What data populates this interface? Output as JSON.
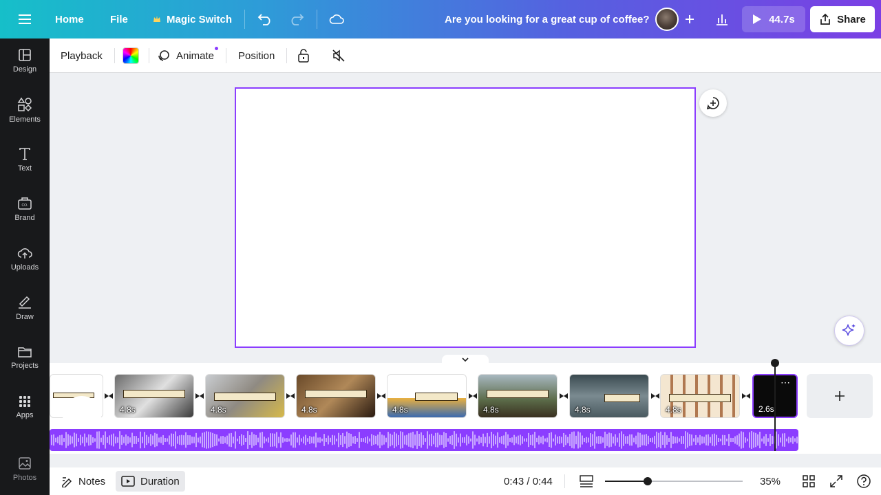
{
  "topbar": {
    "home": "Home",
    "file": "File",
    "magic_switch": "Magic Switch",
    "title": "Are you looking for a great cup of coffee?",
    "play_time": "44.7s",
    "share": "Share"
  },
  "sidebar": {
    "items": [
      {
        "label": "Design",
        "icon": "design-icon"
      },
      {
        "label": "Elements",
        "icon": "elements-icon"
      },
      {
        "label": "Text",
        "icon": "text-icon"
      },
      {
        "label": "Brand",
        "icon": "brand-icon"
      },
      {
        "label": "Uploads",
        "icon": "uploads-icon"
      },
      {
        "label": "Draw",
        "icon": "draw-icon"
      },
      {
        "label": "Projects",
        "icon": "projects-icon"
      },
      {
        "label": "Apps",
        "icon": "apps-icon"
      },
      {
        "label": "Photos",
        "icon": "photos-icon"
      }
    ]
  },
  "toolbar": {
    "playback": "Playback",
    "animate": "Animate",
    "position": "Position"
  },
  "timeline": {
    "clips": [
      {
        "duration": ""
      },
      {
        "duration": "4.8s"
      },
      {
        "duration": "4.8s"
      },
      {
        "duration": "4.8s"
      },
      {
        "duration": "4.8s"
      },
      {
        "duration": "4.8s"
      },
      {
        "duration": "4.8s"
      },
      {
        "duration": "4.8s"
      },
      {
        "duration": "2.6s"
      }
    ]
  },
  "footer": {
    "notes": "Notes",
    "duration": "Duration",
    "time": "0:43 / 0:44",
    "zoom": "35%",
    "zoom_level": 0.31
  },
  "colors": {
    "accent": "#8b3dff",
    "sidebar_bg": "#18191b"
  }
}
